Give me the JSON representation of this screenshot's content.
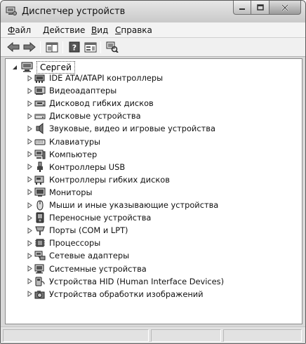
{
  "window": {
    "title": "Диспетчер устройств"
  },
  "menu": [
    "Файл",
    "Действие",
    "Вид",
    "Справка"
  ],
  "toolbar": {
    "icons": [
      "back-arrow-icon",
      "forward-arrow-icon",
      "show-hide-console-tree-icon",
      "help-icon",
      "properties-icon",
      "scan-hardware-icon"
    ]
  },
  "tree": {
    "root": "Сергей",
    "items": [
      {
        "label": "IDE ATA/ATAPI контроллеры",
        "icon": "ide-controller-icon"
      },
      {
        "label": "Видеоадаптеры",
        "icon": "display-adapter-icon"
      },
      {
        "label": "Дисковод гибких дисков",
        "icon": "floppy-drive-icon"
      },
      {
        "label": "Дисковые устройства",
        "icon": "disk-drive-icon"
      },
      {
        "label": "Звуковые, видео и игровые устройства",
        "icon": "speaker-icon"
      },
      {
        "label": "Клавиатуры",
        "icon": "keyboard-icon"
      },
      {
        "label": "Компьютер",
        "icon": "computer-icon"
      },
      {
        "label": "Контроллеры USB",
        "icon": "usb-icon"
      },
      {
        "label": "Контроллеры гибких дисков",
        "icon": "floppy-controller-icon"
      },
      {
        "label": "Мониторы",
        "icon": "monitor-icon"
      },
      {
        "label": "Мыши и иные указывающие устройства",
        "icon": "mouse-icon"
      },
      {
        "label": "Переносные устройства",
        "icon": "portable-device-icon"
      },
      {
        "label": "Порты (COM и LPT)",
        "icon": "port-icon"
      },
      {
        "label": "Процессоры",
        "icon": "processor-icon"
      },
      {
        "label": "Сетевые адаптеры",
        "icon": "network-adapter-icon"
      },
      {
        "label": "Системные устройства",
        "icon": "system-device-icon"
      },
      {
        "label": "Устройства HID (Human Interface Devices)",
        "icon": "hid-icon"
      },
      {
        "label": "Устройства обработки изображений",
        "icon": "camera-icon"
      }
    ]
  }
}
